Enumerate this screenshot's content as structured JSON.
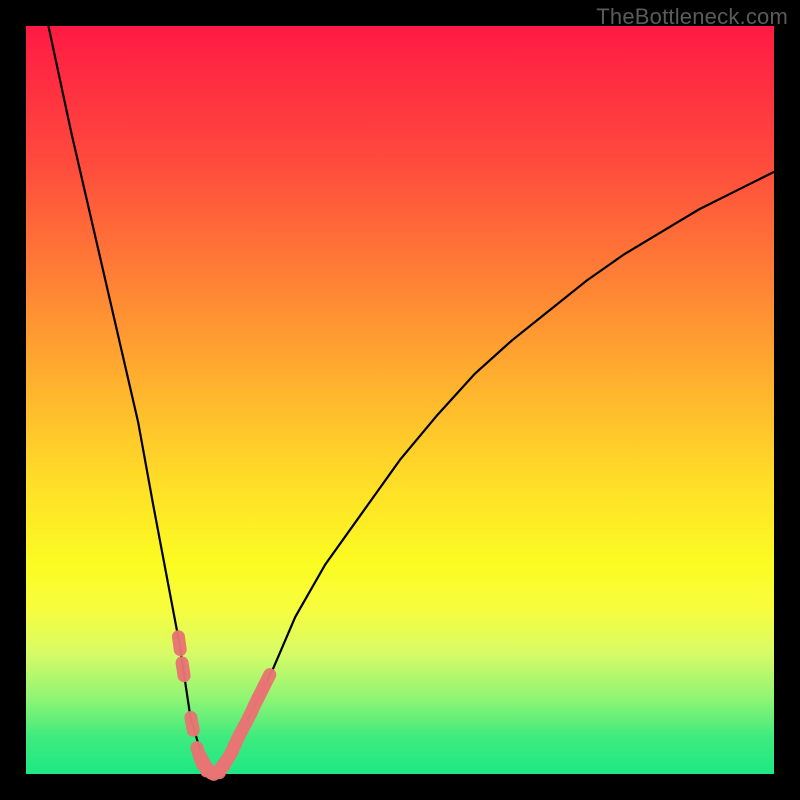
{
  "watermark": "TheBottleneck.com",
  "chart_data": {
    "type": "line",
    "title": "",
    "xlabel": "",
    "ylabel": "",
    "xlim": [
      0,
      100
    ],
    "ylim": [
      0,
      100
    ],
    "grid": false,
    "x": [
      3,
      6,
      9,
      12,
      15,
      17,
      20.5,
      22,
      23.8,
      25,
      27,
      30,
      33,
      36,
      40,
      45,
      50,
      55,
      60,
      65,
      70,
      75,
      80,
      85,
      90,
      95,
      100
    ],
    "series": [
      {
        "name": "bottleneck-curve",
        "values": [
          100,
          86,
          73,
          60,
          47,
          36,
          17.5,
          7.5,
          1.5,
          0.3,
          2,
          8,
          14,
          21,
          28,
          35,
          42,
          48,
          53.5,
          58,
          62,
          66,
          69.5,
          72.5,
          75.5,
          78,
          80.5
        ]
      }
    ],
    "marker_series": {
      "name": "highlighted-range",
      "x": [
        20.5,
        21.0,
        22.2,
        23.1,
        23.8,
        24.2,
        25.0,
        25.8,
        26.7,
        27.2,
        27.6,
        28.2,
        28.8,
        29.8,
        30.7,
        31.4,
        32.2
      ],
      "values": [
        17.5,
        14.0,
        6.7,
        2.7,
        1.5,
        0.7,
        0.3,
        0.5,
        1.7,
        2.4,
        3.2,
        4.5,
        5.7,
        7.6,
        9.5,
        10.9,
        12.5
      ]
    }
  }
}
